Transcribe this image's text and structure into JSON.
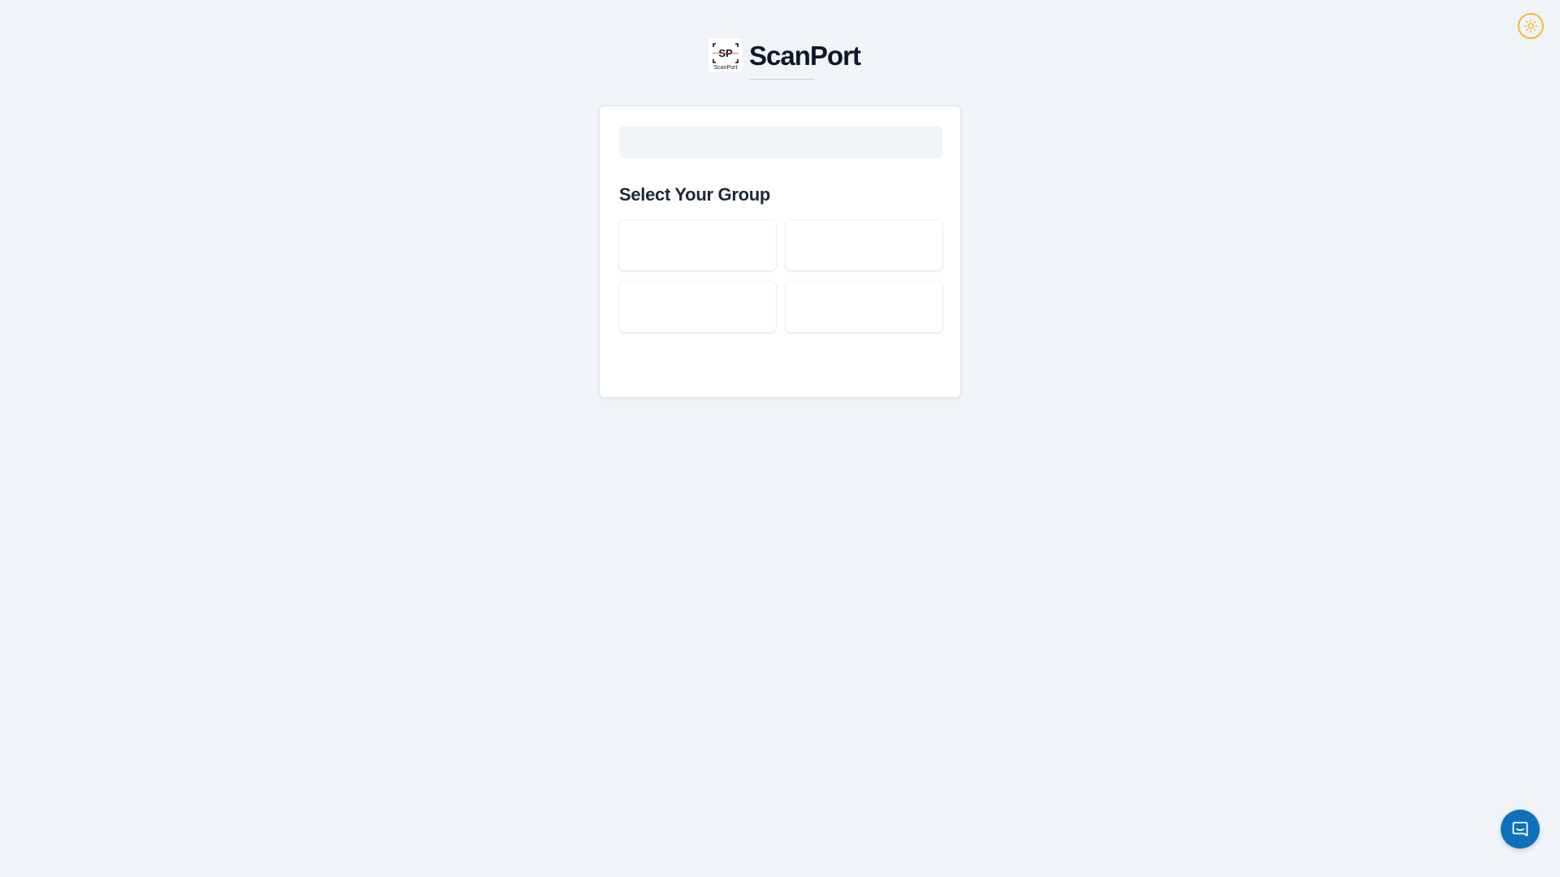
{
  "brand": {
    "name": "ScanPort",
    "logo_text": "ScanPort",
    "logo_icon": "scanport-logo"
  },
  "theme_toggle": {
    "icon": "sun-icon",
    "color": "#f5b82e"
  },
  "card": {
    "title": "Select Your Group",
    "groups": [
      {
        "label": ""
      },
      {
        "label": ""
      },
      {
        "label": ""
      },
      {
        "label": ""
      }
    ]
  },
  "chat": {
    "icon": "chat-bubble-icon",
    "color": "#0d72b9"
  },
  "colors": {
    "background": "#f0f4f9",
    "card": "#ffffff",
    "skeleton": "#f1f4f8"
  }
}
